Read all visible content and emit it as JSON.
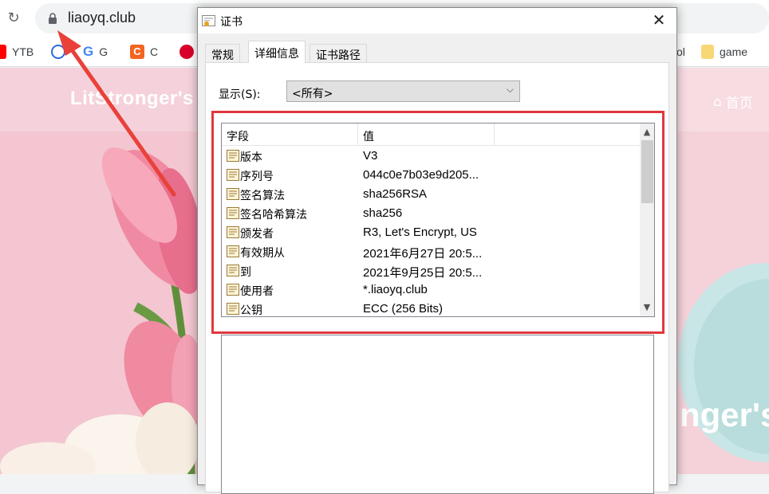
{
  "browser": {
    "url": "liaoyq.club",
    "bookmarks": [
      {
        "label": "YTB",
        "color": "#ff0000"
      },
      {
        "label": "",
        "color": "#2b6cd6"
      },
      {
        "label": "G",
        "color": "#4285f4"
      },
      {
        "label": "C",
        "color": "#f26522"
      },
      {
        "label": "",
        "color": "#d9002a"
      },
      {
        "label": "ol",
        "color": "#000000"
      },
      {
        "label": "game",
        "color": "#f8d775"
      }
    ]
  },
  "page": {
    "site_title": "LitStronger's",
    "nav_home": "首页",
    "hero_text": "nger's w"
  },
  "dialog": {
    "title": "证书",
    "tabs": [
      "常规",
      "详细信息",
      "证书路径"
    ],
    "active_tab": "详细信息",
    "show_label": "显示(S):",
    "show_value": "<所有>",
    "columns": [
      "字段",
      "值"
    ],
    "rows": [
      {
        "field": "版本",
        "value": "V3"
      },
      {
        "field": "序列号",
        "value": "044c0e7b03e9d205..."
      },
      {
        "field": "签名算法",
        "value": "sha256RSA"
      },
      {
        "field": "签名哈希算法",
        "value": "sha256"
      },
      {
        "field": "颁发者",
        "value": "R3, Let's Encrypt, US"
      },
      {
        "field": "有效期从",
        "value": "2021年6月27日 20:5..."
      },
      {
        "field": "到",
        "value": "2021年9月25日 20:5..."
      },
      {
        "field": "使用者",
        "value": "*.liaoyq.club"
      },
      {
        "field": "公钥",
        "value": "ECC (256 Bits)"
      }
    ]
  },
  "colors": {
    "highlight": "#e0383e",
    "arrow": "#e9413a",
    "page_bg": "#f5d2da"
  }
}
